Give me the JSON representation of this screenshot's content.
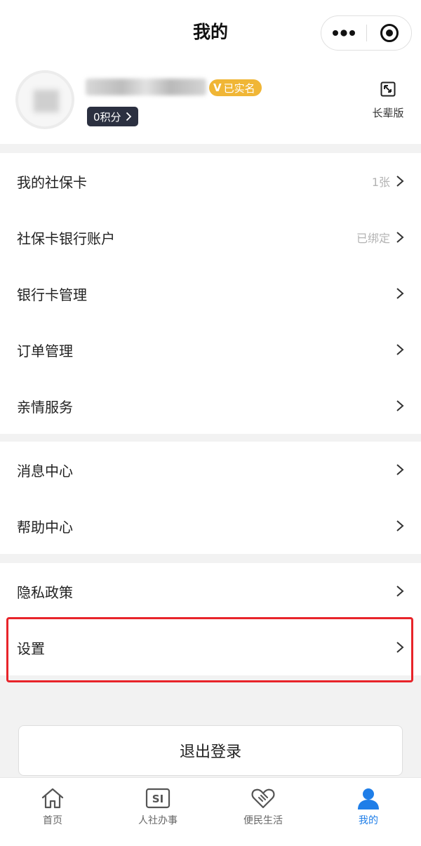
{
  "nav": {
    "title": "我的"
  },
  "profile": {
    "verified_label": "已实名",
    "points_label": "0积分",
    "elder_mode_label": "长辈版"
  },
  "menu_groups": [
    [
      {
        "label": "我的社保卡",
        "value": "1张"
      },
      {
        "label": "社保卡银行账户",
        "value": "已绑定"
      },
      {
        "label": "银行卡管理",
        "value": ""
      },
      {
        "label": "订单管理",
        "value": ""
      },
      {
        "label": "亲情服务",
        "value": ""
      }
    ],
    [
      {
        "label": "消息中心",
        "value": ""
      },
      {
        "label": "帮助中心",
        "value": ""
      }
    ],
    [
      {
        "label": "隐私政策",
        "value": ""
      },
      {
        "label": "设置",
        "value": ""
      }
    ]
  ],
  "logout_label": "退出登录",
  "tabs": [
    {
      "label": "首页",
      "icon": "home-icon"
    },
    {
      "label": "人社办事",
      "icon": "si-icon"
    },
    {
      "label": "便民生活",
      "icon": "handshake-heart-icon"
    },
    {
      "label": "我的",
      "icon": "person-icon"
    }
  ],
  "colors": {
    "accent": "#1f7ee8",
    "verified": "#f0b636",
    "highlight": "#e8242a",
    "points_bg": "#2b3040"
  }
}
